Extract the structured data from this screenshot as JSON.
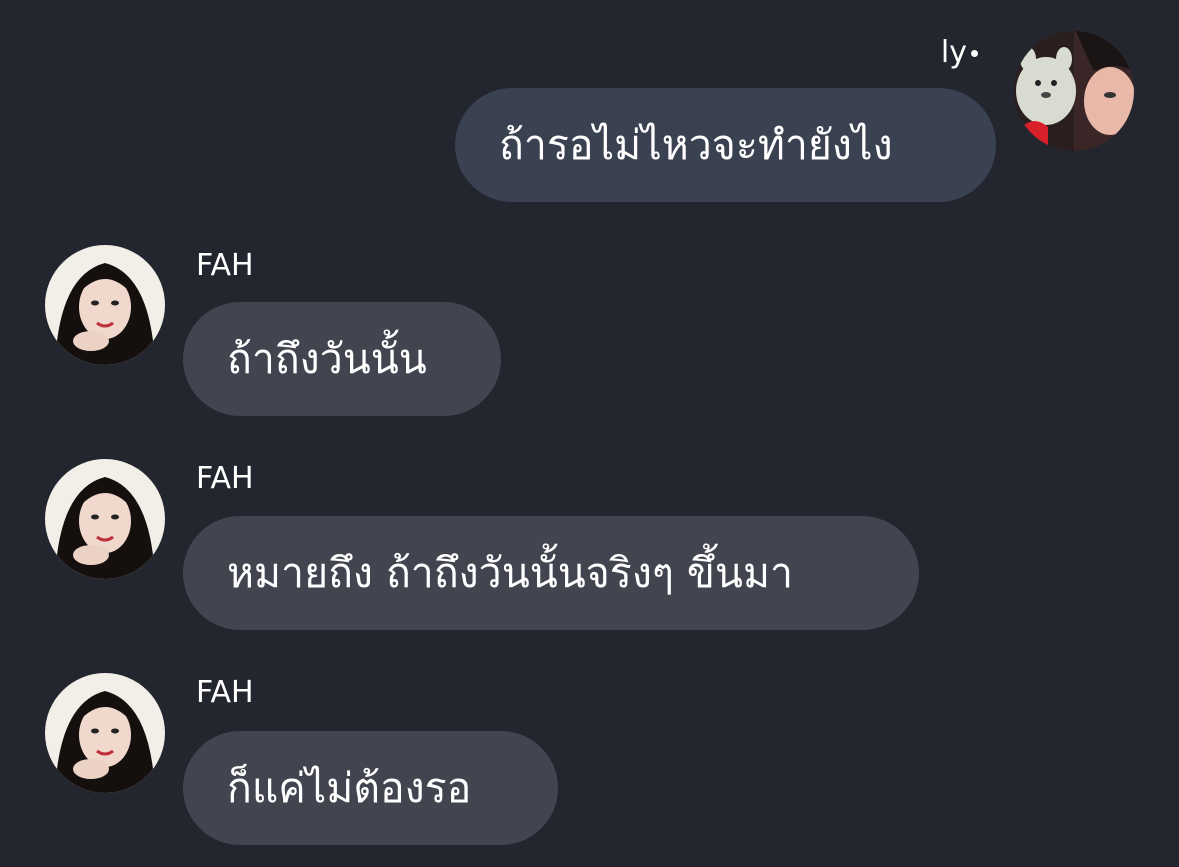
{
  "messages": [
    {
      "direction": "outgoing",
      "sender": "ly",
      "text": "ถ้ารอไม่ไหวจะทำยังไง"
    },
    {
      "direction": "incoming",
      "sender": "FAH",
      "text": "ถ้าถึงวันนั้น"
    },
    {
      "direction": "incoming",
      "sender": "FAH",
      "text": "หมายถึง ถ้าถึงวันนั้นจริงๆ ขึ้นมา"
    },
    {
      "direction": "incoming",
      "sender": "FAH",
      "text": "ก็แค่ไม่ต้องรอ"
    }
  ],
  "colors": {
    "background": "#23262e",
    "outgoing_bubble": "#3a4252",
    "incoming_bubble": "#42454f",
    "text": "#ffffff"
  },
  "icons": {
    "outgoing_avatar": "profile-photo-with-plush-toy",
    "incoming_avatar": "profile-photo-woman"
  }
}
